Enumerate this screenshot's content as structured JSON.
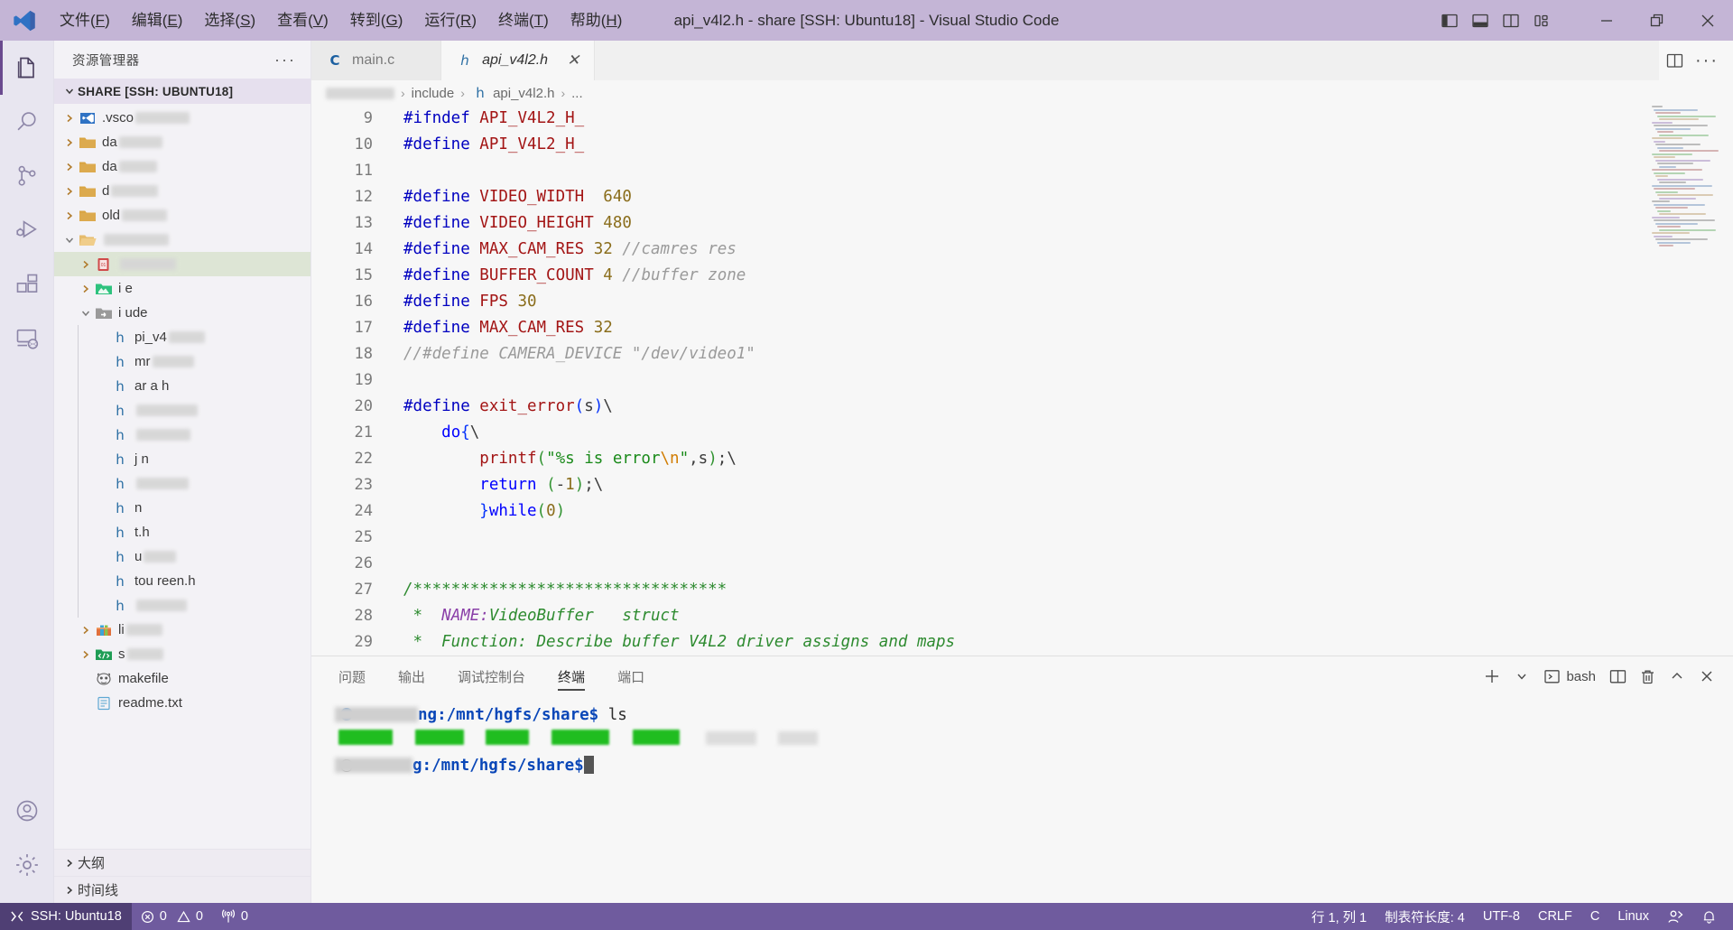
{
  "window": {
    "title": "api_v4l2.h - share [SSH: Ubuntu18] - Visual Studio Code",
    "menu": [
      "文件(F)",
      "编辑(E)",
      "选择(S)",
      "查看(V)",
      "转到(G)",
      "运行(R)",
      "终端(T)",
      "帮助(H)"
    ],
    "layout_buttons": [
      "toggle-primary-sidebar",
      "toggle-panel",
      "toggle-secondary-sidebar",
      "customize-layout"
    ],
    "controls": {
      "minimize": "—",
      "maximize": "❐",
      "close": "✕"
    },
    "titlebar_color": "#c4b5d6"
  },
  "activitybar": {
    "items": [
      {
        "name": "explorer",
        "active": true
      },
      {
        "name": "search",
        "active": false
      },
      {
        "name": "source-control",
        "active": false
      },
      {
        "name": "run-and-debug",
        "active": false
      },
      {
        "name": "extensions",
        "active": false
      },
      {
        "name": "remote-explorer",
        "active": false
      }
    ],
    "bottom": [
      {
        "name": "accounts"
      },
      {
        "name": "manage-settings"
      }
    ]
  },
  "sidebar": {
    "header": "资源管理器",
    "more_actions": "···",
    "root_label": "SHARE [SSH: UBUNTU18]",
    "tree": [
      {
        "label": ".vsco",
        "redacted_after": 60,
        "indent": 1,
        "twisty": "collapsed",
        "icon": "vscode-folder",
        "selected": false
      },
      {
        "label": "da",
        "redacted_after": 48,
        "indent": 1,
        "twisty": "collapsed",
        "icon": "folder",
        "selected": false
      },
      {
        "label": "da",
        "redacted_after": 42,
        "indent": 1,
        "twisty": "collapsed",
        "icon": "folder",
        "selected": false
      },
      {
        "label": "d",
        "redacted_after": 52,
        "indent": 1,
        "twisty": "collapsed",
        "icon": "folder",
        "selected": false
      },
      {
        "label": "old",
        "redacted_after": 50,
        "indent": 1,
        "twisty": "collapsed",
        "icon": "folder",
        "selected": false
      },
      {
        "label": "",
        "redacted_after": 72,
        "indent": 1,
        "twisty": "expanded",
        "icon": "folder-open",
        "selected": false
      },
      {
        "label": "",
        "redacted_after": 62,
        "indent": 2,
        "twisty": "collapsed",
        "icon": "folder-red",
        "selected": true
      },
      {
        "label": "i     e",
        "redacted_after": 0,
        "indent": 2,
        "twisty": "collapsed",
        "icon": "folder-green",
        "selected": false
      },
      {
        "label": "i   ude",
        "redacted_after": 0,
        "indent": 2,
        "twisty": "expanded",
        "icon": "folder-gray",
        "selected": false
      },
      {
        "label": "pi_v4    ",
        "redacted_after": 40,
        "indent": 3,
        "twisty": "none",
        "icon": "h-file",
        "selected": false
      },
      {
        "label": "mr",
        "redacted_after": 46,
        "indent": 3,
        "twisty": "none",
        "icon": "h-file",
        "selected": false
      },
      {
        "label": "ar    a h",
        "redacted_after": 0,
        "indent": 3,
        "twisty": "none",
        "icon": "h-file",
        "selected": false
      },
      {
        "label": "",
        "redacted_after": 68,
        "indent": 3,
        "twisty": "none",
        "icon": "h-file",
        "selected": false
      },
      {
        "label": "",
        "redacted_after": 60,
        "indent": 3,
        "twisty": "none",
        "icon": "h-file",
        "selected": false
      },
      {
        "label": "j          n",
        "redacted_after": 0,
        "indent": 3,
        "twisty": "none",
        "icon": "h-file",
        "selected": false
      },
      {
        "label": "",
        "redacted_after": 58,
        "indent": 3,
        "twisty": "none",
        "icon": "h-file",
        "selected": false
      },
      {
        "label": "          n",
        "redacted_after": 0,
        "indent": 3,
        "twisty": "none",
        "icon": "h-file",
        "selected": false
      },
      {
        "label": "        t.h",
        "redacted_after": 0,
        "indent": 3,
        "twisty": "none",
        "icon": "h-file",
        "selected": false
      },
      {
        "label": "  u",
        "redacted_after": 36,
        "indent": 3,
        "twisty": "none",
        "icon": "h-file",
        "selected": false
      },
      {
        "label": "tou    reen.h",
        "redacted_after": 0,
        "indent": 3,
        "twisty": "none",
        "icon": "h-file",
        "selected": false
      },
      {
        "label": "",
        "redacted_after": 56,
        "indent": 3,
        "twisty": "none",
        "icon": "h-file",
        "selected": false
      },
      {
        "label": "li",
        "redacted_after": 40,
        "indent": 2,
        "twisty": "collapsed",
        "icon": "folder-lib",
        "selected": false
      },
      {
        "label": "s",
        "redacted_after": 40,
        "indent": 2,
        "twisty": "collapsed",
        "icon": "folder-src",
        "selected": false
      },
      {
        "label": "makefile",
        "redacted_after": 0,
        "indent": 2,
        "twisty": "none",
        "icon": "makefile",
        "selected": false
      },
      {
        "label": "readme.txt",
        "redacted_after": 0,
        "indent": 2,
        "twisty": "none",
        "icon": "txt-file",
        "selected": false
      }
    ],
    "sections": [
      {
        "label": "大纲",
        "state": "collapsed"
      },
      {
        "label": "时间线",
        "state": "collapsed"
      }
    ]
  },
  "editor": {
    "tabs": [
      {
        "label": "main.c",
        "icon": "c-file",
        "active": false,
        "preview": false,
        "closable": false
      },
      {
        "label": "api_v4l2.h",
        "icon": "h-file",
        "active": true,
        "preview": true,
        "closable": true
      }
    ],
    "tab_actions": [
      "split-editor",
      "more-actions"
    ],
    "breadcrumb": [
      "",
      "include",
      "api_v4l2.h",
      "..."
    ],
    "breadcrumb_first_redacted": true,
    "first_line_number": 9,
    "lines": [
      {
        "n": 9,
        "tokens": [
          {
            "t": "#ifndef ",
            "c": "k-pp"
          },
          {
            "t": "API_V4L2_H_",
            "c": "k-macro"
          }
        ]
      },
      {
        "n": 10,
        "tokens": [
          {
            "t": "#define ",
            "c": "k-pp"
          },
          {
            "t": "API_V4L2_H_",
            "c": "k-macro"
          }
        ]
      },
      {
        "n": 11,
        "tokens": []
      },
      {
        "n": 12,
        "tokens": [
          {
            "t": "#define ",
            "c": "k-pp"
          },
          {
            "t": "VIDEO_WIDTH",
            "c": "k-macro"
          },
          {
            "t": "  ",
            "c": "k-punc"
          },
          {
            "t": "640",
            "c": "k-num"
          }
        ]
      },
      {
        "n": 13,
        "tokens": [
          {
            "t": "#define ",
            "c": "k-pp"
          },
          {
            "t": "VIDEO_HEIGHT",
            "c": "k-macro"
          },
          {
            "t": " ",
            "c": "k-punc"
          },
          {
            "t": "480",
            "c": "k-num"
          }
        ]
      },
      {
        "n": 14,
        "tokens": [
          {
            "t": "#define ",
            "c": "k-pp"
          },
          {
            "t": "MAX_CAM_RES",
            "c": "k-macro"
          },
          {
            "t": " ",
            "c": "k-punc"
          },
          {
            "t": "32",
            "c": "k-num"
          },
          {
            "t": " ",
            "c": "k-punc"
          },
          {
            "t": "//camres res",
            "c": "k-cmt"
          }
        ]
      },
      {
        "n": 15,
        "tokens": [
          {
            "t": "#define ",
            "c": "k-pp"
          },
          {
            "t": "BUFFER_COUNT",
            "c": "k-macro"
          },
          {
            "t": " ",
            "c": "k-punc"
          },
          {
            "t": "4",
            "c": "k-num"
          },
          {
            "t": " ",
            "c": "k-punc"
          },
          {
            "t": "//buffer zone",
            "c": "k-cmt"
          }
        ]
      },
      {
        "n": 16,
        "tokens": [
          {
            "t": "#define ",
            "c": "k-pp"
          },
          {
            "t": "FPS",
            "c": "k-macro"
          },
          {
            "t": " ",
            "c": "k-punc"
          },
          {
            "t": "30",
            "c": "k-num"
          }
        ]
      },
      {
        "n": 17,
        "tokens": [
          {
            "t": "#define ",
            "c": "k-pp"
          },
          {
            "t": "MAX_CAM_RES",
            "c": "k-macro"
          },
          {
            "t": " ",
            "c": "k-punc"
          },
          {
            "t": "32",
            "c": "k-num"
          }
        ]
      },
      {
        "n": 18,
        "tokens": [
          {
            "t": "//#define CAMERA_DEVICE \"/dev/video1\"",
            "c": "k-cmt"
          }
        ]
      },
      {
        "n": 19,
        "tokens": []
      },
      {
        "n": 20,
        "tokens": [
          {
            "t": "#define ",
            "c": "k-pp"
          },
          {
            "t": "exit_error",
            "c": "k-macro"
          },
          {
            "t": "(",
            "c": "k-paren1"
          },
          {
            "t": "s",
            "c": "k-var"
          },
          {
            "t": ")",
            "c": "k-paren1"
          },
          {
            "t": "\\",
            "c": "k-punc"
          }
        ]
      },
      {
        "n": 21,
        "tokens": [
          {
            "t": "    ",
            "c": "k-punc"
          },
          {
            "t": "do",
            "c": "k-key"
          },
          {
            "t": "{",
            "c": "k-paren1"
          },
          {
            "t": "\\",
            "c": "k-punc"
          }
        ]
      },
      {
        "n": 22,
        "tokens": [
          {
            "t": "        ",
            "c": "k-punc"
          },
          {
            "t": "printf",
            "c": "k-fn"
          },
          {
            "t": "(",
            "c": "k-paren2"
          },
          {
            "t": "\"%s is error",
            "c": "k-str"
          },
          {
            "t": "\\n",
            "c": "k-esc"
          },
          {
            "t": "\"",
            "c": "k-str"
          },
          {
            "t": ",",
            "c": "k-punc"
          },
          {
            "t": "s",
            "c": "k-var"
          },
          {
            "t": ")",
            "c": "k-paren2"
          },
          {
            "t": ";",
            "c": "k-punc"
          },
          {
            "t": "\\",
            "c": "k-punc"
          }
        ]
      },
      {
        "n": 23,
        "tokens": [
          {
            "t": "        ",
            "c": "k-punc"
          },
          {
            "t": "return",
            "c": "k-key"
          },
          {
            "t": " ",
            "c": "k-punc"
          },
          {
            "t": "(",
            "c": "k-paren2"
          },
          {
            "t": "-",
            "c": "k-punc"
          },
          {
            "t": "1",
            "c": "k-num"
          },
          {
            "t": ")",
            "c": "k-paren2"
          },
          {
            "t": ";",
            "c": "k-punc"
          },
          {
            "t": "\\",
            "c": "k-punc"
          }
        ]
      },
      {
        "n": 24,
        "tokens": [
          {
            "t": "        ",
            "c": "k-punc"
          },
          {
            "t": "}",
            "c": "k-paren1"
          },
          {
            "t": "while",
            "c": "k-key"
          },
          {
            "t": "(",
            "c": "k-paren2"
          },
          {
            "t": "0",
            "c": "k-num"
          },
          {
            "t": ")",
            "c": "k-paren2"
          }
        ]
      },
      {
        "n": 25,
        "tokens": []
      },
      {
        "n": 26,
        "tokens": []
      },
      {
        "n": 27,
        "tokens": [
          {
            "t": "/*********************************",
            "c": "k-blk"
          }
        ]
      },
      {
        "n": 28,
        "tokens": [
          {
            "t": " *  ",
            "c": "k-blk"
          },
          {
            "t": "NAME:",
            "c": "k-tag"
          },
          {
            "t": "VideoBuffer   struct",
            "c": "k-blk"
          }
        ]
      },
      {
        "n": 29,
        "tokens": [
          {
            "t": " *  Function: Describe buffer V4L2 driver assigns and maps",
            "c": "k-blk"
          }
        ]
      }
    ],
    "minimap_visible": true
  },
  "panel": {
    "tabs": [
      {
        "label": "问题",
        "active": false
      },
      {
        "label": "输出",
        "active": false
      },
      {
        "label": "调试控制台",
        "active": false
      },
      {
        "label": "终端",
        "active": true
      },
      {
        "label": "端口",
        "active": false
      }
    ],
    "actions": {
      "new_terminal": "+",
      "new_terminal_dropdown": "⌄",
      "shell_label": "bash",
      "split": "split-terminal",
      "kill": "kill-terminal",
      "maximize": "^",
      "close": "✕"
    },
    "terminal": {
      "lines": [
        {
          "prompt_redacted": true,
          "prompt_tail": "ng:/mnt/hgfs/share$",
          "command": " ls",
          "bullet": "filled"
        },
        {
          "output_redacted": true
        },
        {
          "prompt_redacted": true,
          "prompt_tail": "g:/mnt/hgfs/share$",
          "command": "",
          "bullet": "hollow",
          "cursor": true
        }
      ]
    }
  },
  "statusbar": {
    "remote": "SSH: Ubuntu18",
    "errors": "0",
    "warnings": "0",
    "radio_tower": "0",
    "right": {
      "cursor": "行 1, 列 1",
      "indent": "制表符长度: 4",
      "encoding": "UTF-8",
      "eol": "CRLF",
      "language": "C",
      "platform": "Linux",
      "live_share": "person-add-icon",
      "notifications": "bell-icon"
    },
    "background": "#6f5b9e",
    "remote_background": "#4f3f74"
  }
}
